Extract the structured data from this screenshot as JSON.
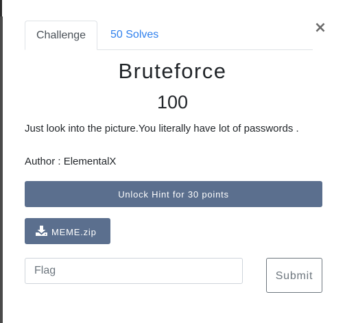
{
  "modal": {
    "close_glyph": "×",
    "tabs": [
      {
        "label": "Challenge",
        "active": true
      },
      {
        "label": "50 Solves",
        "active": false
      }
    ],
    "challenge": {
      "name": "Bruteforce",
      "points": "100",
      "description": "Just look into the picture.You literally have lot of passwords .",
      "author": "Author : ElementalX"
    },
    "hint_button_label": "Unlock Hint for 30 points",
    "file": {
      "icon": "download-icon",
      "label": "MEME.zip"
    },
    "flag_input": {
      "value": "",
      "placeholder": "Flag"
    },
    "submit_label": "Submit"
  },
  "colors": {
    "button_bg": "#5b6f8e",
    "link": "#2f80ed",
    "text": "#212529",
    "muted": "#6c757d"
  }
}
